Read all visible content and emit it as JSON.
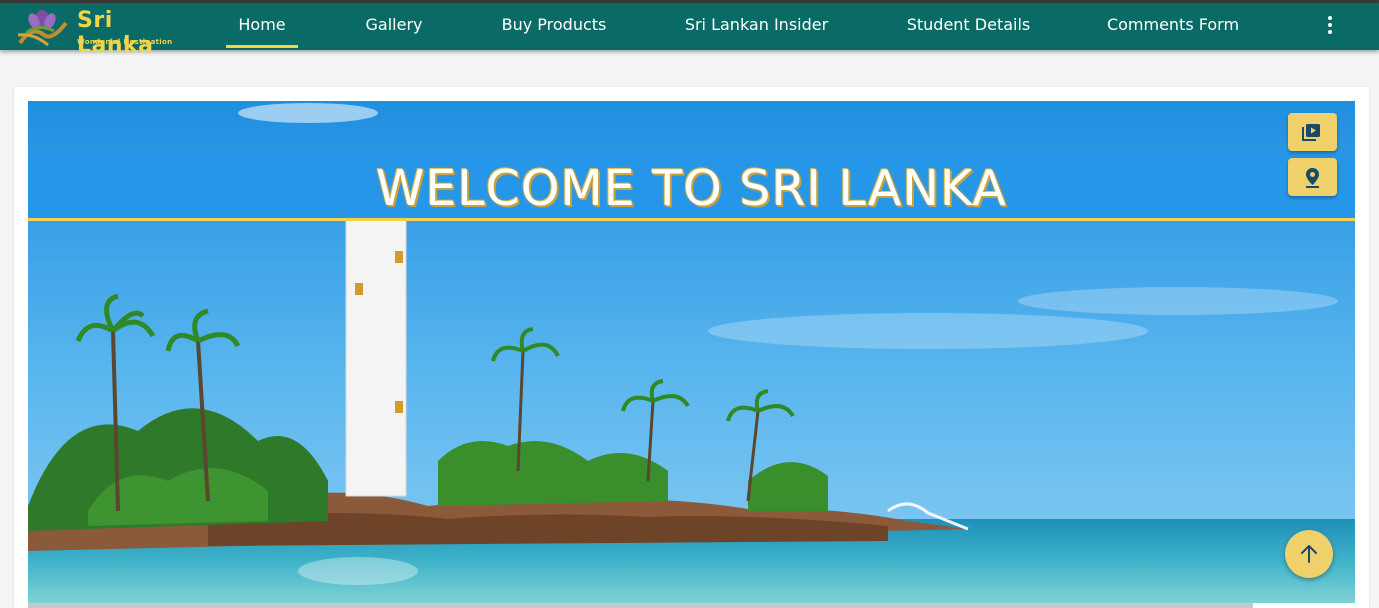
{
  "brand": {
    "title": "Sri Lanka",
    "tagline": "Wonderful Destination"
  },
  "nav": {
    "items": [
      {
        "label": "Home",
        "active": true
      },
      {
        "label": "Gallery"
      },
      {
        "label": "Buy Products"
      },
      {
        "label": "Sri Lankan Insider"
      },
      {
        "label": "Student Details"
      },
      {
        "label": "Comments Form"
      }
    ],
    "more_icon": "more-vert-icon"
  },
  "hero": {
    "banner_text": "WELCOME TO SRI LANKA",
    "side_buttons": [
      {
        "icon": "video-library-icon"
      },
      {
        "icon": "location-pin-icon"
      }
    ],
    "fab_icon": "arrow-up-icon"
  },
  "colors": {
    "navbar": "#0a6b66",
    "accent": "#f2d34a",
    "banner": "#2596e8",
    "button": "#f0d06a"
  }
}
